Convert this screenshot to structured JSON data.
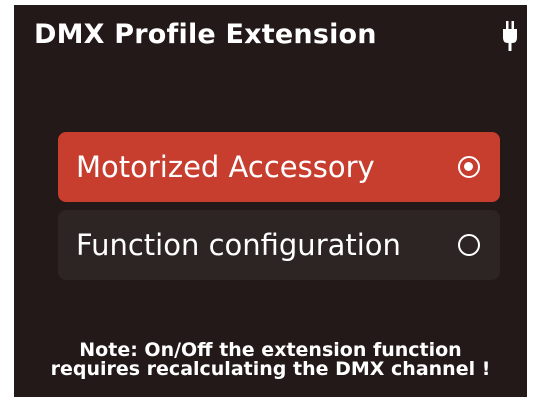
{
  "header": {
    "title": "DMX Profile Extension",
    "status_icon": "plug-icon"
  },
  "options": [
    {
      "label": "Motorized Accessory",
      "selected": true
    },
    {
      "label": "Function configuration",
      "selected": false
    }
  ],
  "note": {
    "line1": "Note: On/Off the extension function",
    "line2": "requires recalculating the DMX channel !"
  },
  "colors": {
    "background": "#231918",
    "selected": "#c73d2e",
    "unselected": "#2d2424",
    "text": "#ffffff"
  }
}
